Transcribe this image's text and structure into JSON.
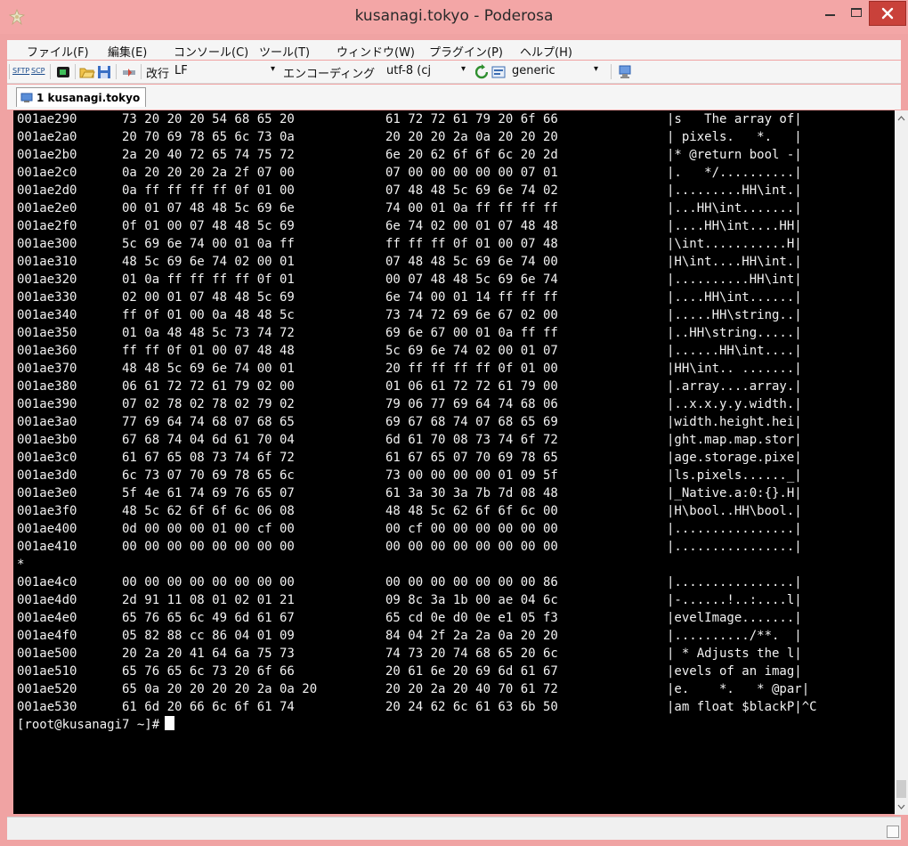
{
  "window": {
    "title": "kusanagi.tokyo - Poderosa"
  },
  "menu": [
    "ファイル(F)",
    "編集(E)",
    "コンソール(C)",
    "ツール(T)",
    "ウィンドウ(W)",
    "プラグイン(P)",
    "ヘルプ(H)"
  ],
  "toolbar": {
    "sftp": "SFTP",
    "scp": "SCP",
    "newline_label": "改行",
    "newline_value": "LF",
    "encoding_label": "エンコーディング",
    "encoding_value": "utf-8 (cj",
    "terminal_value": "generic"
  },
  "tab": {
    "label": "1  kusanagi.tokyo"
  },
  "terminal": {
    "lines": [
      {
        "a": "001ae290",
        "h1": "73 20 20 20 54 68 65 20",
        "h2": "61 72 72 61 79 20 6f 66",
        "t": "|s   The array of|"
      },
      {
        "a": "001ae2a0",
        "h1": "20 70 69 78 65 6c 73 0a",
        "h2": "20 20 20 2a 0a 20 20 20",
        "t": "| pixels.   *.   |"
      },
      {
        "a": "001ae2b0",
        "h1": "2a 20 40 72 65 74 75 72",
        "h2": "6e 20 62 6f 6f 6c 20 2d",
        "t": "|* @return bool -|"
      },
      {
        "a": "001ae2c0",
        "h1": "0a 20 20 20 2a 2f 07 00",
        "h2": "07 00 00 00 00 00 07 01",
        "t": "|.   */..........|"
      },
      {
        "a": "001ae2d0",
        "h1": "0a ff ff ff ff 0f 01 00",
        "h2": "07 48 48 5c 69 6e 74 02",
        "t": "|.........HH\\int.|"
      },
      {
        "a": "001ae2e0",
        "h1": "00 01 07 48 48 5c 69 6e",
        "h2": "74 00 01 0a ff ff ff ff",
        "t": "|...HH\\int.......|"
      },
      {
        "a": "001ae2f0",
        "h1": "0f 01 00 07 48 48 5c 69",
        "h2": "6e 74 02 00 01 07 48 48",
        "t": "|....HH\\int....HH|"
      },
      {
        "a": "001ae300",
        "h1": "5c 69 6e 74 00 01 0a ff",
        "h2": "ff ff ff 0f 01 00 07 48",
        "t": "|\\int...........H|"
      },
      {
        "a": "001ae310",
        "h1": "48 5c 69 6e 74 02 00 01",
        "h2": "07 48 48 5c 69 6e 74 00",
        "t": "|H\\int....HH\\int.|"
      },
      {
        "a": "001ae320",
        "h1": "01 0a ff ff ff ff 0f 01",
        "h2": "00 07 48 48 5c 69 6e 74",
        "t": "|..........HH\\int|"
      },
      {
        "a": "001ae330",
        "h1": "02 00 01 07 48 48 5c 69",
        "h2": "6e 74 00 01 14 ff ff ff",
        "t": "|....HH\\int......|"
      },
      {
        "a": "001ae340",
        "h1": "ff 0f 01 00 0a 48 48 5c",
        "h2": "73 74 72 69 6e 67 02 00",
        "t": "|.....HH\\string..|"
      },
      {
        "a": "001ae350",
        "h1": "01 0a 48 48 5c 73 74 72",
        "h2": "69 6e 67 00 01 0a ff ff",
        "t": "|..HH\\string.....|"
      },
      {
        "a": "001ae360",
        "h1": "ff ff 0f 01 00 07 48 48",
        "h2": "5c 69 6e 74 02 00 01 07",
        "t": "|......HH\\int....|"
      },
      {
        "a": "001ae370",
        "h1": "48 48 5c 69 6e 74 00 01",
        "h2": "20 ff ff ff ff 0f 01 00",
        "t": "|HH\\int.. .......|"
      },
      {
        "a": "001ae380",
        "h1": "06 61 72 72 61 79 02 00",
        "h2": "01 06 61 72 72 61 79 00",
        "t": "|.array....array.|"
      },
      {
        "a": "001ae390",
        "h1": "07 02 78 02 78 02 79 02",
        "h2": "79 06 77 69 64 74 68 06",
        "t": "|..x.x.y.y.width.|"
      },
      {
        "a": "001ae3a0",
        "h1": "77 69 64 74 68 07 68 65",
        "h2": "69 67 68 74 07 68 65 69",
        "t": "|width.height.hei|"
      },
      {
        "a": "001ae3b0",
        "h1": "67 68 74 04 6d 61 70 04",
        "h2": "6d 61 70 08 73 74 6f 72",
        "t": "|ght.map.map.stor|"
      },
      {
        "a": "001ae3c0",
        "h1": "61 67 65 08 73 74 6f 72",
        "h2": "61 67 65 07 70 69 78 65",
        "t": "|age.storage.pixe|"
      },
      {
        "a": "001ae3d0",
        "h1": "6c 73 07 70 69 78 65 6c",
        "h2": "73 00 00 00 00 01 09 5f",
        "t": "|ls.pixels......_|"
      },
      {
        "a": "001ae3e0",
        "h1": "5f 4e 61 74 69 76 65 07",
        "h2": "61 3a 30 3a 7b 7d 08 48",
        "t": "|_Native.a:0:{}.H|"
      },
      {
        "a": "001ae3f0",
        "h1": "48 5c 62 6f 6f 6c 06 08",
        "h2": "48 48 5c 62 6f 6f 6c 00",
        "t": "|H\\bool..HH\\bool.|"
      },
      {
        "a": "001ae400",
        "h1": "0d 00 00 00 01 00 cf 00",
        "h2": "00 cf 00 00 00 00 00 00",
        "t": "|................|"
      },
      {
        "a": "001ae410",
        "h1": "00 00 00 00 00 00 00 00",
        "h2": "00 00 00 00 00 00 00 00",
        "t": "|................|"
      },
      {
        "a": "*",
        "h1": "",
        "h2": "",
        "t": ""
      },
      {
        "a": "001ae4c0",
        "h1": "00 00 00 00 00 00 00 00",
        "h2": "00 00 00 00 00 00 00 86",
        "t": "|................|"
      },
      {
        "a": "001ae4d0",
        "h1": "2d 91 11 08 01 02 01 21",
        "h2": "09 8c 3a 1b 00 ae 04 6c",
        "t": "|-......!..:....l|"
      },
      {
        "a": "001ae4e0",
        "h1": "65 76 65 6c 49 6d 61 67",
        "h2": "65 cd 0e d0 0e e1 05 f3",
        "t": "|evelImage.......|"
      },
      {
        "a": "001ae4f0",
        "h1": "05 82 88 cc 86 04 01 09",
        "h2": "84 04 2f 2a 2a 0a 20 20",
        "t": "|........../**.  |"
      },
      {
        "a": "001ae500",
        "h1": "20 2a 20 41 64 6a 75 73",
        "h2": "74 73 20 74 68 65 20 6c",
        "t": "| * Adjusts the l|"
      },
      {
        "a": "001ae510",
        "h1": "65 76 65 6c 73 20 6f 66",
        "h2": "20 61 6e 20 69 6d 61 67",
        "t": "|evels of an imag|"
      },
      {
        "a": "001ae520",
        "h1": "65 0a 20 20 20 20 2a 0a 20",
        "h2": "20 20 2a 20 40 70 61 72",
        "t": "|e.    *.   * @par|"
      },
      {
        "a": "001ae530",
        "h1": "61 6d 20 66 6c 6f 61 74",
        "h2": "20 24 62 6c 61 63 6b 50",
        "t": "|am float $blackP|^C"
      }
    ],
    "prompt": "[root@kusanagi7 ~]#"
  }
}
